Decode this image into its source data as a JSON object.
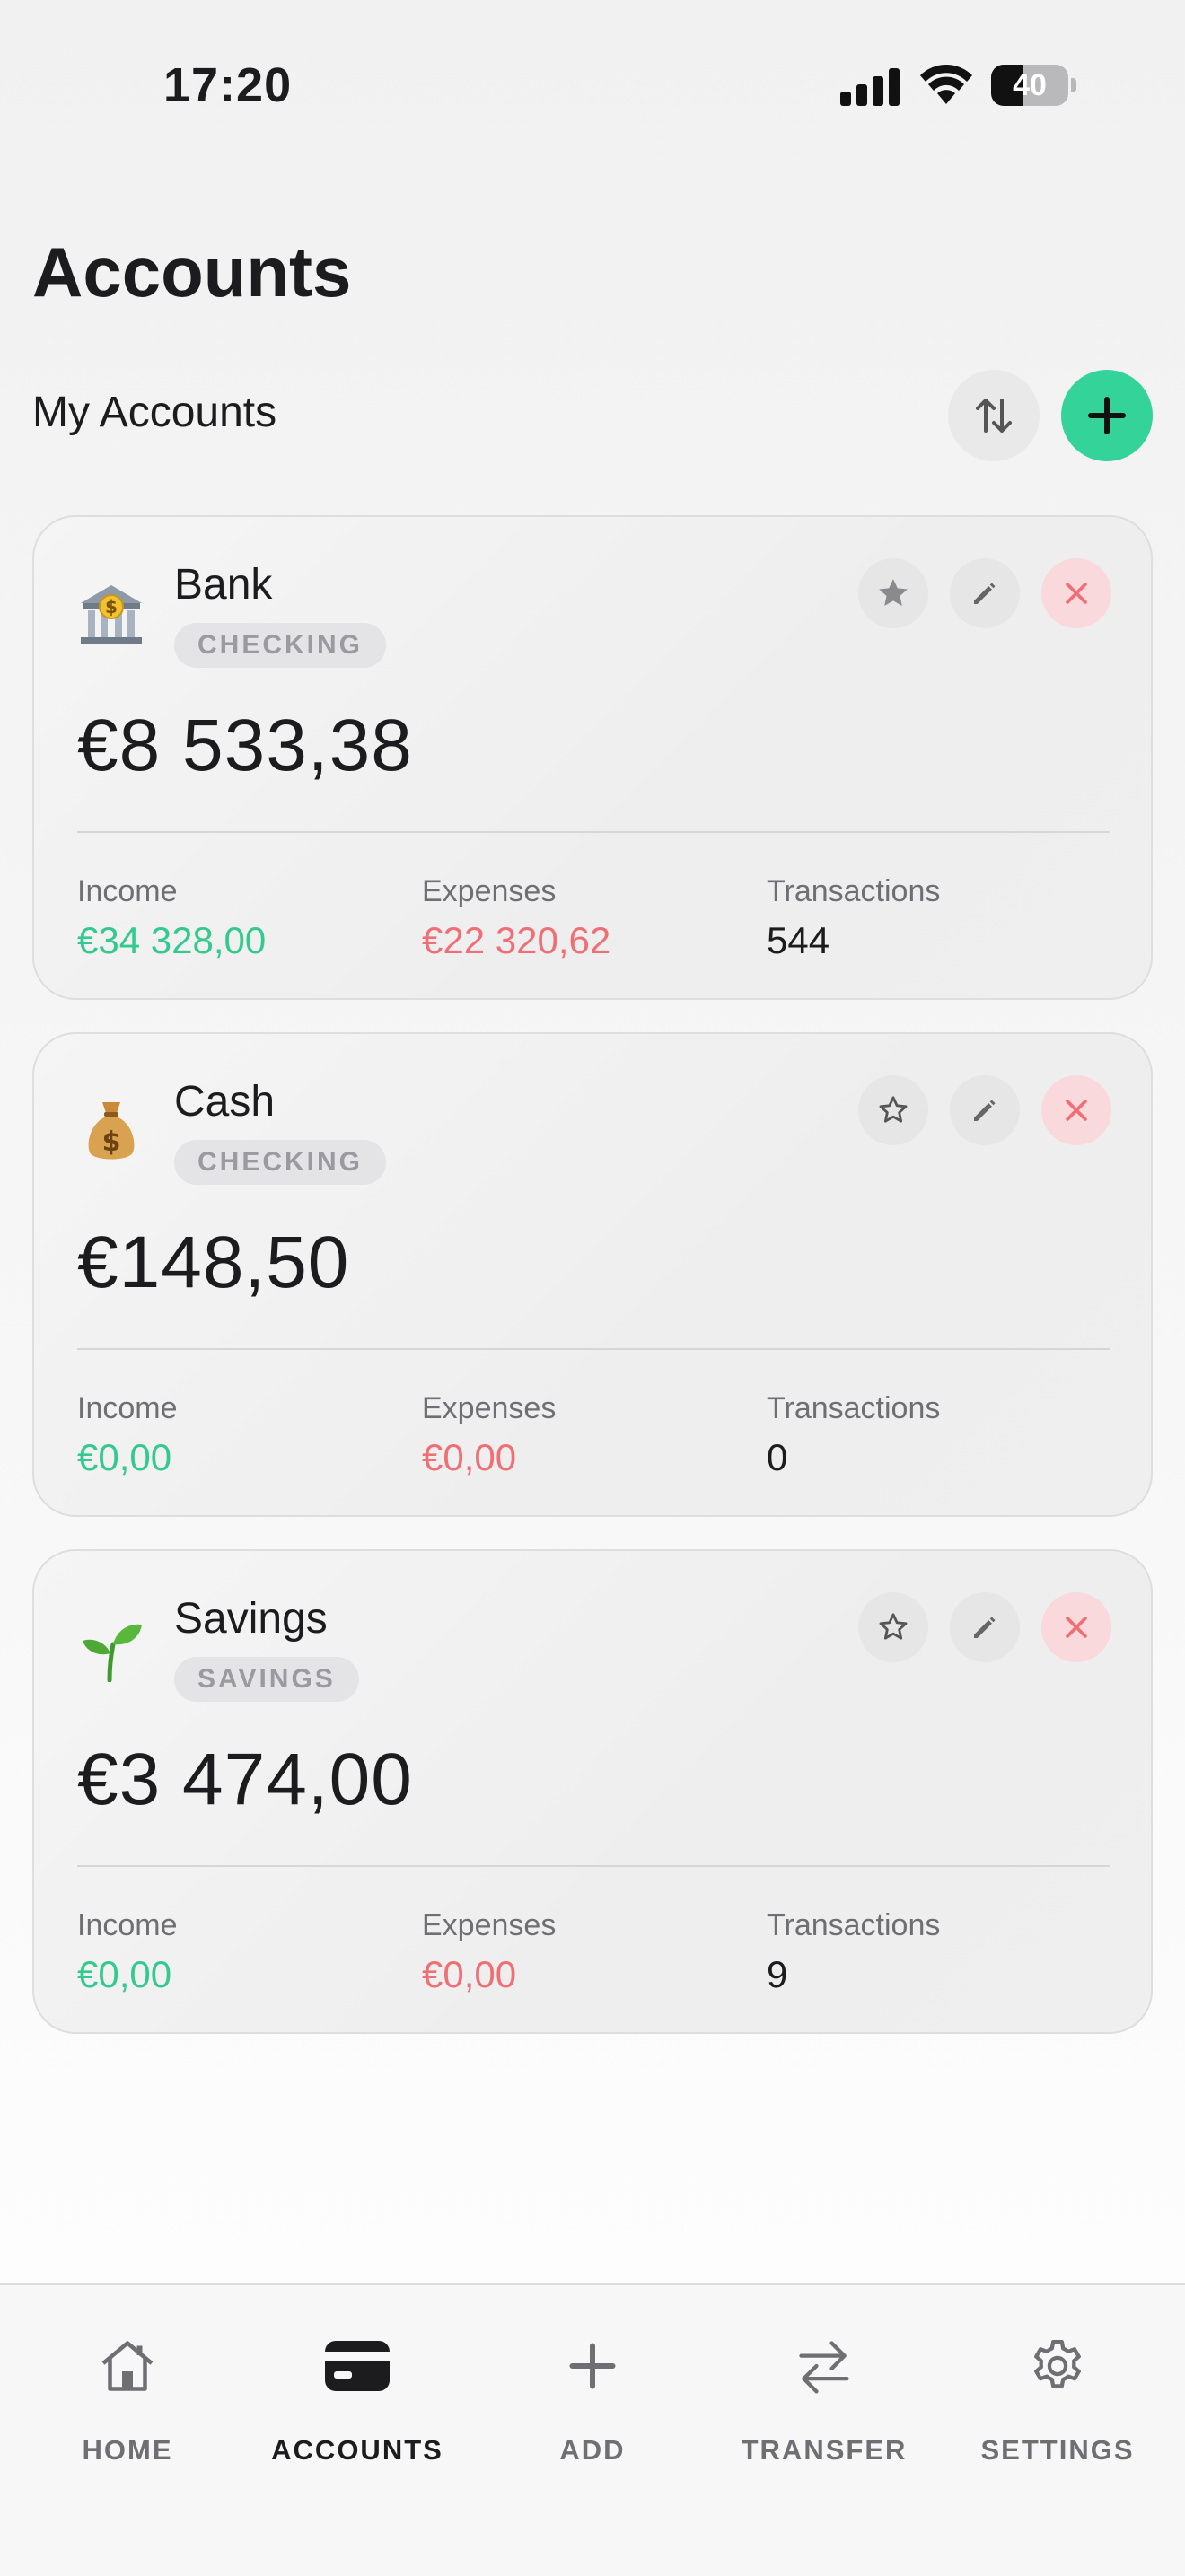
{
  "status_bar": {
    "time": "17:20",
    "battery": "40"
  },
  "header": {
    "title": "Accounts"
  },
  "section": {
    "title": "My Accounts"
  },
  "labels": {
    "income": "Income",
    "expenses": "Expenses",
    "transactions": "Transactions"
  },
  "accounts": [
    {
      "name": "Bank",
      "type": "CHECKING",
      "icon": "bank-icon",
      "balance": "€8 533,38",
      "income": "€34 328,00",
      "expenses": "€22 320,62",
      "transactions": "544",
      "favorite": true
    },
    {
      "name": "Cash",
      "type": "CHECKING",
      "icon": "money-bag-icon",
      "balance": "€148,50",
      "income": "€0,00",
      "expenses": "€0,00",
      "transactions": "0",
      "favorite": false
    },
    {
      "name": "Savings",
      "type": "SAVINGS",
      "icon": "seedling-icon",
      "balance": "€3 474,00",
      "income": "€0,00",
      "expenses": "€0,00",
      "transactions": "9",
      "favorite": false
    }
  ],
  "tabs": [
    {
      "label": "HOME",
      "icon": "home-icon",
      "active": false
    },
    {
      "label": "ACCOUNTS",
      "icon": "card-icon",
      "active": true
    },
    {
      "label": "ADD",
      "icon": "plus-icon",
      "active": false
    },
    {
      "label": "TRANSFER",
      "icon": "transfer-icon",
      "active": false
    },
    {
      "label": "SETTINGS",
      "icon": "gear-icon",
      "active": false
    }
  ],
  "colors": {
    "accent": "#34d399",
    "income": "#34c98e",
    "expense": "#ef6f75",
    "delete_bg": "#f9d9db",
    "delete_fg": "#ef6f75"
  }
}
